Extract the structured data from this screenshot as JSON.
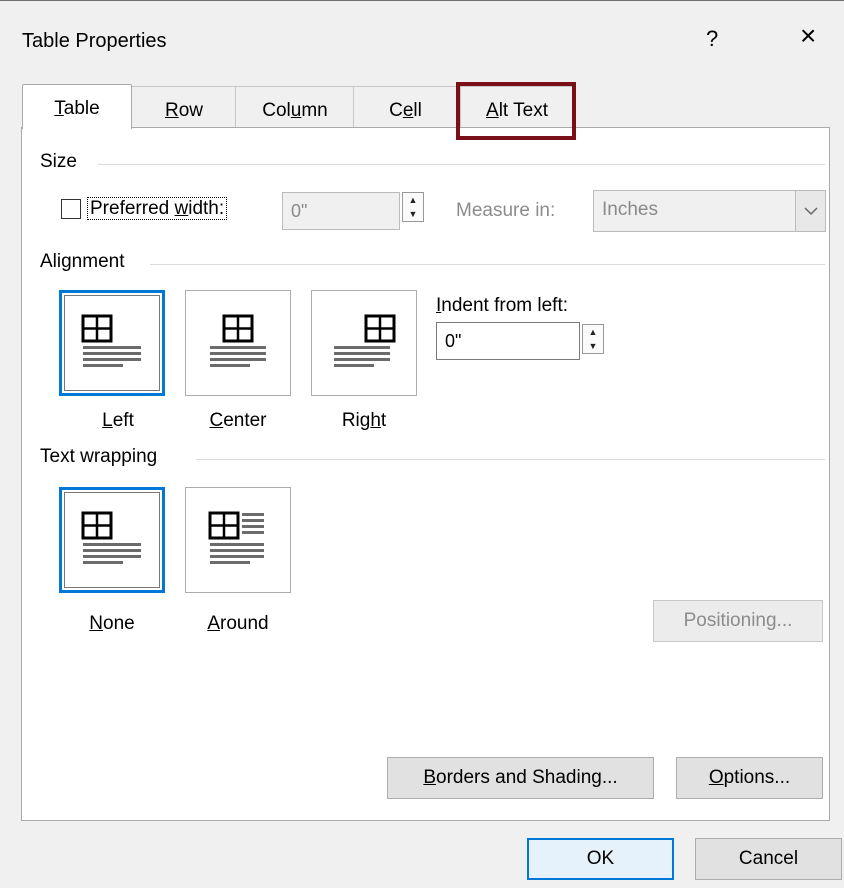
{
  "dialog": {
    "title": "Table Properties",
    "help": "?",
    "close": "×"
  },
  "tabs": [
    {
      "label": "Table",
      "mnemonic": "T",
      "rest": "able",
      "active": true
    },
    {
      "label": "Row",
      "mnemonic": "R",
      "rest": "ow",
      "active": false
    },
    {
      "label": "Column",
      "pre": "Col",
      "mnemonic": "u",
      "rest": "mn",
      "active": false
    },
    {
      "label": "Cell",
      "pre": "C",
      "mnemonic": "e",
      "rest": "ll",
      "active": false
    },
    {
      "label": "Alt Text",
      "mnemonic": "A",
      "rest": "lt Text",
      "active": false,
      "highlighted": true
    }
  ],
  "size": {
    "group_label": "Size",
    "preferred_width_checked": false,
    "preferred_width_label": {
      "pre": "Preferred ",
      "mnemonic": "w",
      "rest": "idth:"
    },
    "width_value": "0\"",
    "measure_in_label": "Measure in:",
    "measure_in_value": "Inches"
  },
  "alignment": {
    "group_label": "Alignment",
    "options": [
      {
        "mnemonic": "L",
        "rest": "eft",
        "selected": true
      },
      {
        "mnemonic": "C",
        "rest": "enter",
        "selected": false
      },
      {
        "pre": "Rig",
        "mnemonic": "h",
        "rest": "t",
        "selected": false
      }
    ],
    "indent_label": {
      "mnemonic": "I",
      "rest": "ndent from left:"
    },
    "indent_value": "0\""
  },
  "text_wrapping": {
    "group_label": "Text wrapping",
    "options": [
      {
        "mnemonic": "N",
        "rest": "one",
        "selected": true
      },
      {
        "mnemonic": "A",
        "rest": "round",
        "selected": false
      }
    ],
    "positioning_label": "Positioning..."
  },
  "bottom_buttons": {
    "borders": {
      "mnemonic": "B",
      "rest": "orders and Shading..."
    },
    "options": {
      "mnemonic": "O",
      "rest": "ptions..."
    },
    "ok": "OK",
    "cancel": "Cancel"
  },
  "colors": {
    "selection_blue": "#0078d7",
    "highlight_box": "#7a1017"
  }
}
